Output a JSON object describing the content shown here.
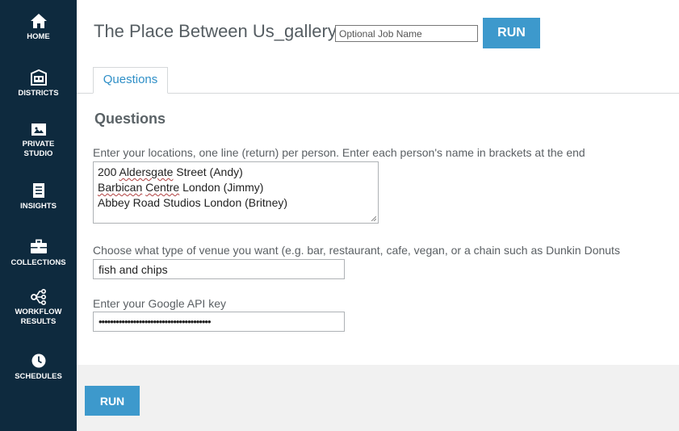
{
  "sidebar": {
    "items": [
      {
        "label": "HOME",
        "icon": "home-icon"
      },
      {
        "label": "DISTRICTS",
        "icon": "districts-icon"
      },
      {
        "label_line1": "PRIVATE",
        "label_line2": "STUDIO",
        "icon": "private-studio-icon"
      },
      {
        "label": "INSIGHTS",
        "icon": "insights-icon"
      },
      {
        "label": "COLLECTIONS",
        "icon": "collections-icon"
      },
      {
        "label_line1": "WORKFLOW",
        "label_line2": "RESULTS",
        "icon": "workflow-results-icon"
      },
      {
        "label": "SCHEDULES",
        "icon": "schedules-icon"
      }
    ]
  },
  "header": {
    "title": "The Place Between Us_gallery",
    "job_name_placeholder": "Optional Job Name",
    "run_label": "RUN"
  },
  "tabs": [
    {
      "label": "Questions"
    }
  ],
  "section": {
    "title": "Questions",
    "locations_label": "Enter your locations, one line (return) per person. Enter each person's name in brackets at the end",
    "locations_lines": [
      [
        "200 ",
        "Aldersgate",
        " Street (Andy)"
      ],
      [
        "Barbican",
        " ",
        "Centre",
        " London (Jimmy)"
      ],
      [
        "Abbey Road Studios London (Britney)"
      ]
    ],
    "venue_label": "Choose what type of venue you want (e.g. bar, restaurant, cafe, vegan, or a chain such as Dunkin Donuts",
    "venue_value": "fish and chips",
    "api_key_label": "Enter your Google API key",
    "api_key_masked": "•••••••••••••••••••••••••••••••••••••••"
  },
  "footer": {
    "run_label": "RUN"
  },
  "colors": {
    "sidebar_bg": "#0e2a3e",
    "accent": "#3d99cc",
    "footer_bg": "#f1f1f1"
  }
}
